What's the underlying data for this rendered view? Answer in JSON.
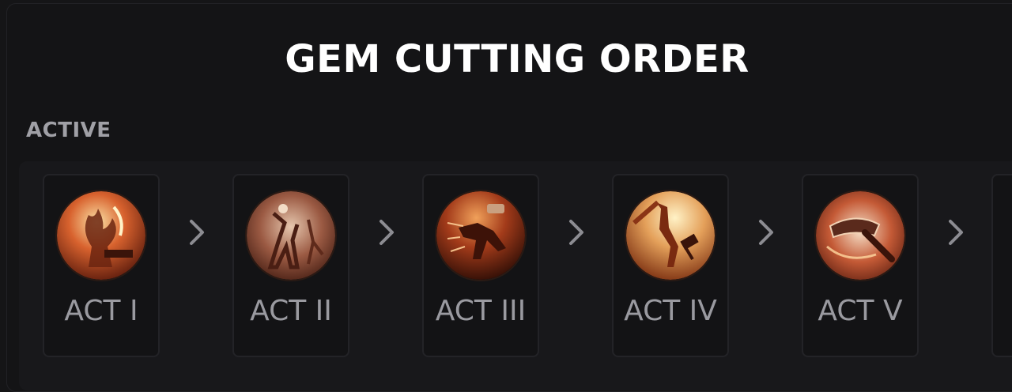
{
  "panel": {
    "title": "GEM CUTTING ORDER",
    "section_label": "ACTIVE"
  },
  "acts": [
    {
      "label": "ACT I",
      "icon": "fire-smith-icon",
      "colors": [
        "#f6c07a",
        "#d8622e",
        "#7a2510"
      ]
    },
    {
      "label": "ACT II",
      "icon": "rock-throw-icon",
      "colors": [
        "#d9b49a",
        "#9b5a43",
        "#4a1e13"
      ]
    },
    {
      "label": "ACT III",
      "icon": "charge-icon",
      "colors": [
        "#e08a48",
        "#a33b1a",
        "#3d1208"
      ]
    },
    {
      "label": "ACT IV",
      "icon": "leap-hammer-icon",
      "colors": [
        "#fae2a8",
        "#e4a05a",
        "#8a3a16"
      ]
    },
    {
      "label": "ACT V",
      "icon": "hammer-icon",
      "colors": [
        "#f0d6bc",
        "#c45a36",
        "#5a1a10"
      ]
    }
  ],
  "theme": {
    "chevron_color": "#8c8c92"
  }
}
